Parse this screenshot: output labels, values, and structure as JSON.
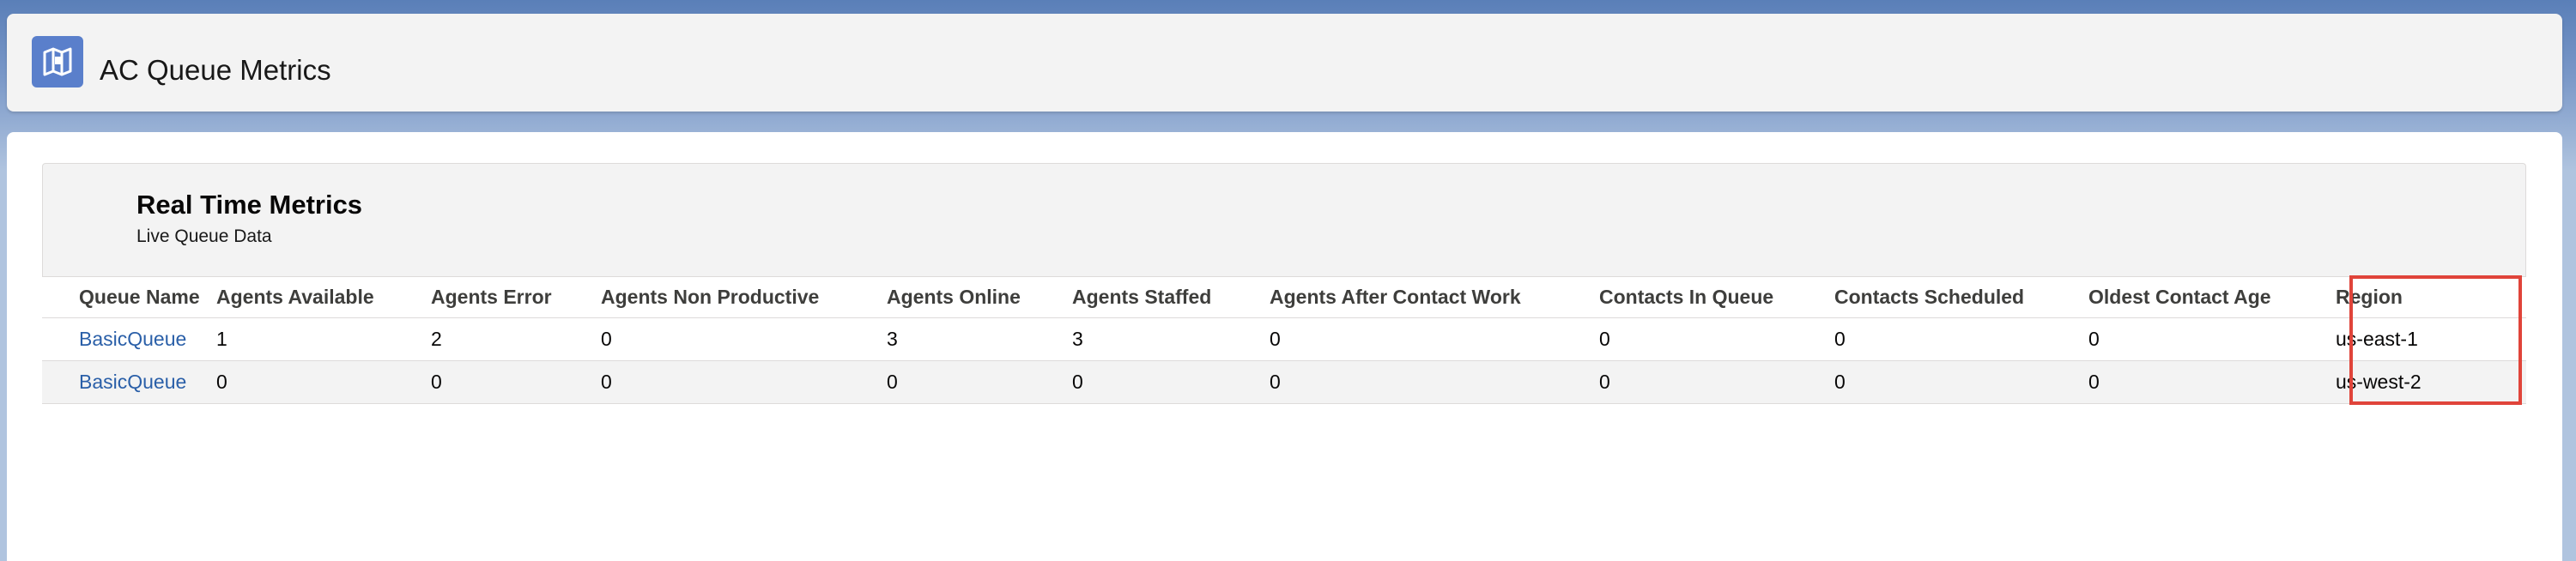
{
  "app": {
    "title": "AC Queue Metrics",
    "icon": "connect-app-icon",
    "icon_color": "#5a7fcb"
  },
  "section": {
    "title": "Real Time Metrics",
    "subtitle": "Live Queue Data"
  },
  "table": {
    "columns": [
      "Queue Name",
      "Agents Available",
      "Agents Error",
      "Agents Non Productive",
      "Agents Online",
      "Agents Staffed",
      "Agents After Contact Work",
      "Contacts In Queue",
      "Contacts Scheduled",
      "Oldest Contact Age",
      "Region"
    ],
    "rows": [
      [
        "BasicQueue",
        "1",
        "2",
        "0",
        "3",
        "3",
        "0",
        "0",
        "0",
        "0",
        "us-east-1"
      ],
      [
        "BasicQueue",
        "0",
        "0",
        "0",
        "0",
        "0",
        "0",
        "0",
        "0",
        "0",
        "us-west-2"
      ]
    ]
  },
  "colors": {
    "link": "#2a5fa8",
    "highlight": "#e0443a",
    "background": "#b0c4df"
  }
}
